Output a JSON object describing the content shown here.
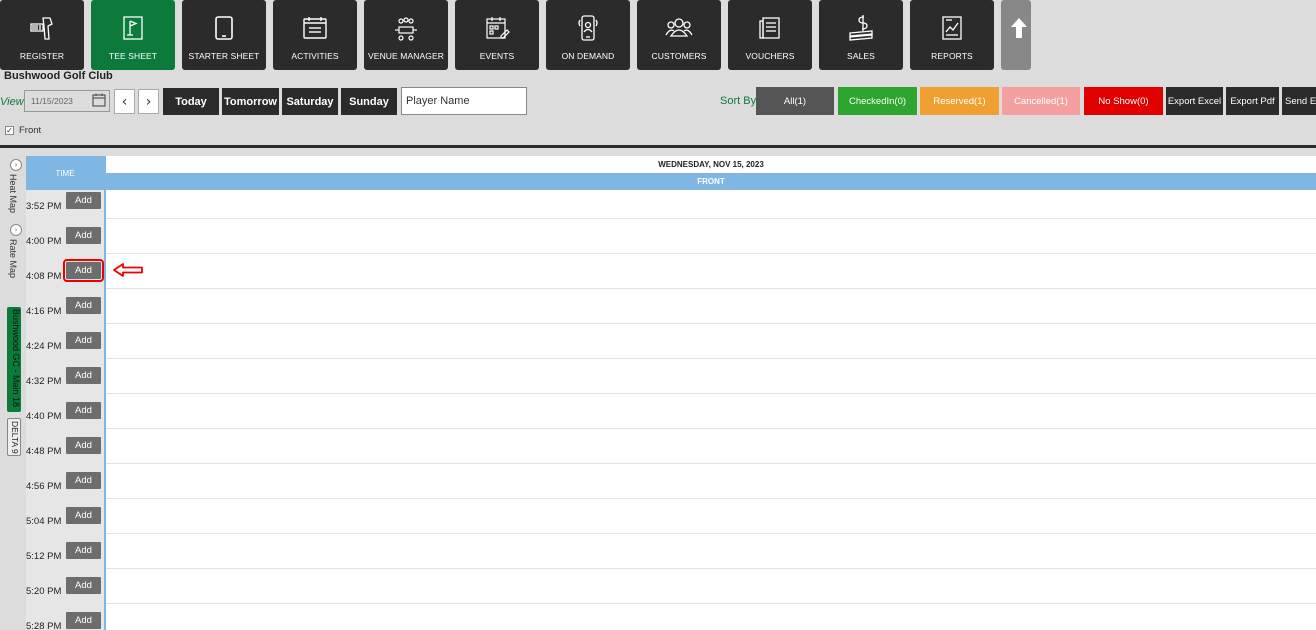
{
  "nav": {
    "buttons": [
      {
        "label": "REGISTER",
        "icon": "barcode-scanner-icon",
        "active": false
      },
      {
        "label": "TEE SHEET",
        "icon": "flag-sheet-icon",
        "active": true
      },
      {
        "label": "STARTER SHEET",
        "icon": "tablet-icon",
        "active": false
      },
      {
        "label": "ACTIVITIES",
        "icon": "calendar-list-icon",
        "active": false
      },
      {
        "label": "VENUE MANAGER",
        "icon": "venue-table-icon",
        "active": false
      },
      {
        "label": "EVENTS",
        "icon": "event-calendar-icon",
        "active": false
      },
      {
        "label": "ON DEMAND",
        "icon": "mobile-user-icon",
        "active": false
      },
      {
        "label": "CUSTOMERS",
        "icon": "group-icon",
        "active": false
      },
      {
        "label": "VOUCHERS",
        "icon": "voucher-icon",
        "active": false
      },
      {
        "label": "SALES",
        "icon": "cash-icon",
        "active": false
      },
      {
        "label": "REPORTS",
        "icon": "report-icon",
        "active": false
      }
    ]
  },
  "club_name": "Bushwood Golf Club",
  "toolbar": {
    "view_label": "View",
    "date_value": "11/15/2023",
    "prev_symbol": "‹",
    "next_symbol": "›",
    "day_buttons": [
      "Today",
      "Tomorrow",
      "Saturday",
      "Sunday"
    ],
    "player_placeholder": "Player Name",
    "sort_by_label": "Sort By",
    "filters": [
      {
        "label": "All(1)",
        "color": "#555555",
        "text_color": "#ffffff"
      },
      {
        "label": "CheckedIn(0)",
        "color": "#2ea52e",
        "text_color": "#ffffff"
      },
      {
        "label": "Reserved(1)",
        "color": "#f0a030",
        "text_color": "#ffffff"
      },
      {
        "label": "Cancelled(1)",
        "color": "#f4a0a0",
        "text_color": "#ffffff"
      },
      {
        "label": "No Show(0)",
        "color": "#e00000",
        "text_color": "#ffffff"
      }
    ],
    "exports": [
      "Export Excel",
      "Export Pdf",
      "Send E"
    ]
  },
  "front_checkbox": {
    "label": "Front",
    "checked": true
  },
  "side_tabs": {
    "heat_map": "Heat Map",
    "rate_map": "Rate Map",
    "course": "Bushwood GC - Main 18",
    "delta": "DELTA 9"
  },
  "grid": {
    "time_header": "TIME",
    "date_header": "WEDNESDAY, NOV 15, 2023",
    "course_header": "FRONT",
    "add_label": "Add",
    "slots": [
      "3:52 PM",
      "4:00 PM",
      "4:08 PM",
      "4:16 PM",
      "4:24 PM",
      "4:32 PM",
      "4:40 PM",
      "4:48 PM",
      "4:56 PM",
      "5:04 PM",
      "5:12 PM",
      "5:20 PM",
      "5:28 PM"
    ],
    "highlighted_slot": "4:08 PM"
  },
  "colors": {
    "brand_green": "#0b7a3b",
    "nav_dark": "#2b2b2b",
    "header_blue": "#7fb6e2",
    "highlight_red": "#e00000"
  }
}
